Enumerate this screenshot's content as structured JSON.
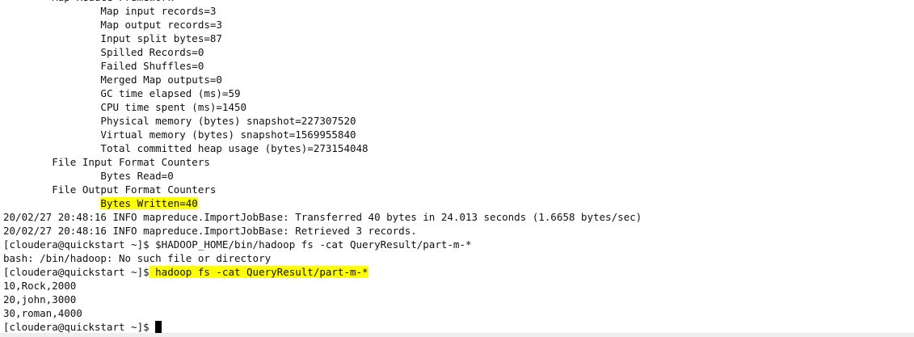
{
  "terminal": {
    "lines": [
      {
        "indent": "        ",
        "text": "Map-Reduce Framework",
        "highlight": false
      },
      {
        "indent": "                ",
        "text": "Map input records=3",
        "highlight": false
      },
      {
        "indent": "                ",
        "text": "Map output records=3",
        "highlight": false
      },
      {
        "indent": "                ",
        "text": "Input split bytes=87",
        "highlight": false
      },
      {
        "indent": "                ",
        "text": "Spilled Records=0",
        "highlight": false
      },
      {
        "indent": "                ",
        "text": "Failed Shuffles=0",
        "highlight": false
      },
      {
        "indent": "                ",
        "text": "Merged Map outputs=0",
        "highlight": false
      },
      {
        "indent": "                ",
        "text": "GC time elapsed (ms)=59",
        "highlight": false
      },
      {
        "indent": "                ",
        "text": "CPU time spent (ms)=1450",
        "highlight": false
      },
      {
        "indent": "                ",
        "text": "Physical memory (bytes) snapshot=227307520",
        "highlight": false
      },
      {
        "indent": "                ",
        "text": "Virtual memory (bytes) snapshot=1569955840",
        "highlight": false
      },
      {
        "indent": "                ",
        "text": "Total committed heap usage (bytes)=273154048",
        "highlight": false
      },
      {
        "indent": "        ",
        "text": "File Input Format Counters",
        "highlight": false
      },
      {
        "indent": "                ",
        "text": "Bytes Read=0",
        "highlight": false
      },
      {
        "indent": "        ",
        "text": "File Output Format Counters",
        "highlight": false
      },
      {
        "indent": "                ",
        "text": "Bytes Written=40",
        "highlight": true
      },
      {
        "indent": "",
        "text": "20/02/27 20:48:16 INFO mapreduce.ImportJobBase: Transferred 40 bytes in 24.013 seconds (1.6658 bytes/sec)",
        "highlight": false
      },
      {
        "indent": "",
        "text": "20/02/27 20:48:16 INFO mapreduce.ImportJobBase: Retrieved 3 records.",
        "highlight": false
      },
      {
        "indent": "",
        "text": "[cloudera@quickstart ~]$ $HADOOP_HOME/bin/hadoop fs -cat QueryResult/part-m-*",
        "highlight": false
      },
      {
        "indent": "",
        "text": "bash: /bin/hadoop: No such file or directory",
        "highlight": false
      },
      {
        "indent": "",
        "text": "[cloudera@quickstart ~]$",
        "highlight": false,
        "suffix": " hadoop fs -cat QueryResult/part-m-*"
      },
      {
        "indent": "",
        "text": "10,Rock,2000",
        "highlight": false
      },
      {
        "indent": "",
        "text": "20,john,3000",
        "highlight": false
      },
      {
        "indent": "",
        "text": "30,roman,4000",
        "highlight": false
      },
      {
        "indent": "",
        "text": "[cloudera@quickstart ~]$ ",
        "highlight": false,
        "cursor": true
      }
    ]
  },
  "colors": {
    "background": "#ffffff",
    "text": "#111111",
    "highlight": "#ffff00",
    "cursor": "#000000"
  }
}
